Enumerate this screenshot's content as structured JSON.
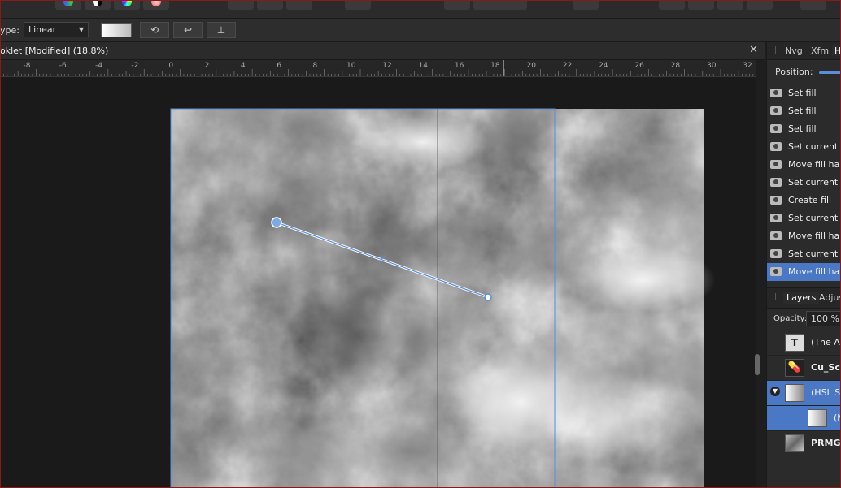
{
  "context_toolbar": {
    "type_label": "ype:",
    "type_value": "Linear"
  },
  "document": {
    "tab_title": "oklet [Modified] (18.8%)",
    "close_glyph": "✕"
  },
  "ruler": {
    "ticks": [
      "-8",
      "-6",
      "-4",
      "-2",
      "0",
      "2",
      "4",
      "6",
      "8",
      "10",
      "12",
      "14",
      "16",
      "18",
      "20",
      "22",
      "24",
      "26",
      "28",
      "30",
      "32"
    ]
  },
  "right_panel": {
    "tabs": [
      "Nvg",
      "Xfm",
      "H"
    ],
    "position_label": "Position:",
    "history": [
      {
        "label": "Set fill",
        "selected": false
      },
      {
        "label": "Set fill",
        "selected": false
      },
      {
        "label": "Set fill",
        "selected": false
      },
      {
        "label": "Set current s",
        "selected": false
      },
      {
        "label": "Move fill han",
        "selected": false
      },
      {
        "label": "Set current s",
        "selected": false
      },
      {
        "label": "Create fill",
        "selected": false
      },
      {
        "label": "Set current s",
        "selected": false
      },
      {
        "label": "Move fill han",
        "selected": false
      },
      {
        "label": "Set current s",
        "selected": false
      },
      {
        "label": "Move fill han",
        "selected": true
      }
    ],
    "layers_tabs": [
      "Layers",
      "Adjus"
    ],
    "opacity_label": "Opacity:",
    "opacity_value": "100 %",
    "layers": [
      {
        "name": "(The Ar",
        "bold": false,
        "selected": false
      },
      {
        "name": "Cu_Scc",
        "bold": true,
        "selected": false
      },
      {
        "name": "(HSL Sh",
        "bold": false,
        "selected": true
      },
      {
        "name": "(M",
        "bold": false,
        "selected": true
      },
      {
        "name": "PRMG_",
        "bold": true,
        "selected": false
      }
    ]
  },
  "colors": {
    "accent": "#4a78c4",
    "selection_line": "#5a8fd8",
    "frame": "#8a1a1a"
  }
}
